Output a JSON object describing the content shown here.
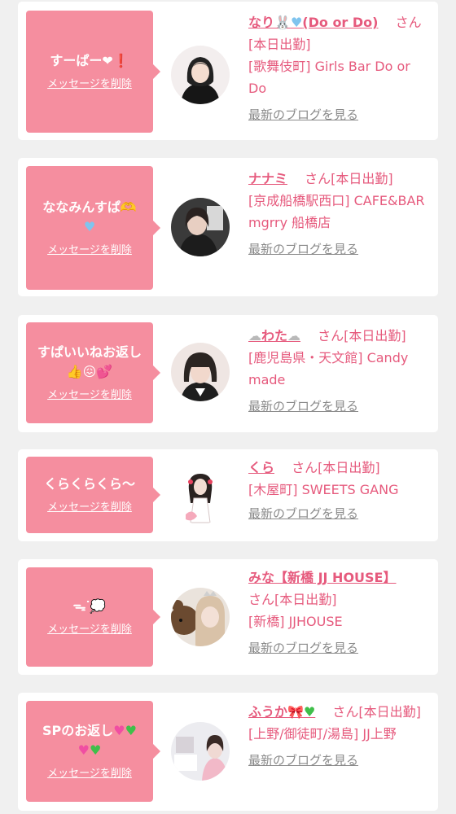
{
  "cards": [
    {
      "message": "すーぱー❤︎❗️",
      "delete_label": "メッセージを削除",
      "name": "なり🐰🩵(Do or Do)",
      "san": "さん",
      "status": "[本日出勤]",
      "location": "[歌舞伎町] Girls Bar Do or Do",
      "blog_link": "最新のブログを見る",
      "avatar": "avatar-photo-woman"
    },
    {
      "message": "ななみんすぱ🫶🩵",
      "delete_label": "メッセージを削除",
      "name": "ナナミ",
      "san": "さん",
      "status": "[本日出勤]",
      "location": "[京成船橋駅西口] CAFE&BAR mgrry 船橋店",
      "blog_link": "最新のブログを見る",
      "avatar": "avatar-photo-woman"
    },
    {
      "message": "すぱいいねお返し👍😖💕",
      "delete_label": "メッセージを削除",
      "name": "☁️わた☁️",
      "san": "さん",
      "status": "[本日出勤]",
      "location": "[鹿児島県・天文館] Candy made",
      "blog_link": "最新のブログを見る",
      "avatar": "avatar-photo-woman"
    },
    {
      "message": "くらくらくら〜",
      "delete_label": "メッセージを削除",
      "name": "くら",
      "san": "さん",
      "status": "[本日出勤]",
      "location": "[木屋町] SWEETS GANG",
      "blog_link": "最新のブログを見る",
      "avatar": "avatar-photo-woman"
    },
    {
      "message": "ᯓᐝ💭",
      "delete_label": "メッセージを削除",
      "name": "みな【新橋 JJ HOUSE】",
      "san": "さん",
      "status": "[本日出勤]",
      "location": "[新橋] JJHOUSE",
      "blog_link": "最新のブログを見る",
      "avatar": "avatar-photo-woman"
    },
    {
      "message": "SPのお返し💗💚💗💚",
      "delete_label": "メッセージを削除",
      "name": "ふうか🎀💚",
      "san": "さん",
      "status": "[本日出勤]",
      "location": "[上野/御徒町/湯島] JJ上野",
      "blog_link": "最新のブログを見る",
      "avatar": "avatar-photo-woman"
    }
  ]
}
